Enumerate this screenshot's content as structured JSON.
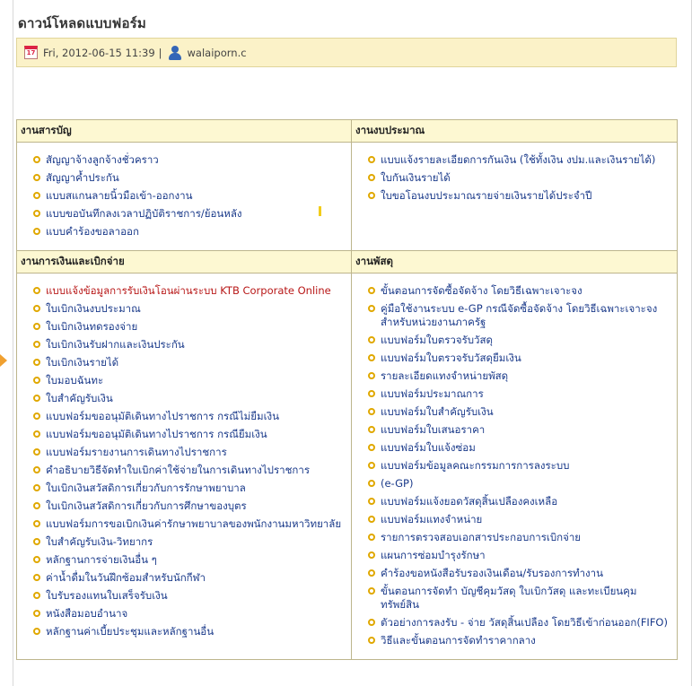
{
  "page": {
    "title": "ดาวน์โหลดแบบฟอร์ม",
    "date": "Fri, 2012-06-15 11:39",
    "separator": "|",
    "author": "walaiporn.c",
    "calendar_icon_text": "17"
  },
  "sections": {
    "general": {
      "title": "งานสารบัญ",
      "items": [
        "สัญญาจ้างลูกจ้างชั่วคราว",
        "สัญญาค้ำประกัน",
        "แบบสแกนลายนิ้วมือเข้า-ออกงาน",
        "แบบขอบันทึกลงเวลาปฏิบัติราชการ/ย้อนหลัง",
        "แบบคำร้องขอลาออก"
      ]
    },
    "budget": {
      "title": "งานงบประมาณ",
      "items": [
        "แบบแจ้งรายละเอียดการกันเงิน (ใช้ทั้งเงิน งปม.และเงินรายได้)",
        "ใบกันเงินรายได้",
        "ใบขอโอนงบประมาณรายจ่ายเงินรายได้ประจำปี"
      ]
    },
    "finance": {
      "title": "งานการเงินและเบิกจ่าย",
      "items": [
        "แบบแจ้งข้อมูลการรับเงินโอนผ่านระบบ KTB Corporate Online",
        "ใบเบิกเงินงบประมาณ",
        "ใบเบิกเงินทดรองจ่าย",
        "ใบเบิกเงินรับฝากและเงินประกัน",
        "ใบเบิกเงินรายได้",
        "ใบมอบฉันทะ",
        "ใบสำคัญรับเงิน",
        "แบบฟอร์มขออนุมัติเดินทางไปราชการ กรณีไม่ยืมเงิน",
        "แบบฟอร์มขออนุมัติเดินทางไปราชการ กรณียืมเงิน",
        "แบบฟอร์มรายงานการเดินทางไปราชการ",
        "คำอธิบายวิธีจัดทำใบเบิกค่าใช้จ่ายในการเดินทางไปราชการ",
        "ใบเบิกเงินสวัสดิการเกี่ยวกับการรักษาพยาบาล",
        "ใบเบิกเงินสวัสดิการเกี่ยวกับการศึกษาของบุตร",
        "แบบฟอร์มการขอเบิกเงินค่ารักษาพยาบาลของพนักงานมหาวิทยาลัย",
        "ใบสำคัญรับเงิน-วิทยากร",
        "หลักฐานการจ่ายเงินอื่น ๆ",
        "ค่าน้ำดื่มในวันฝึกซ้อมสำหรับนักกีฬา",
        "ใบรับรองแทนใบเสร็จรับเงิน",
        "หนังสือมอบอำนาจ",
        "หลักฐานค่าเบี้ยประชุมและหลักฐานอื่น"
      ]
    },
    "supplies": {
      "title": "งานพัสดุ",
      "items": [
        "ขั้นตอนการจัดซื้อจัดจ้าง โดยวิธีเฉพาะเจาะจง",
        "คู่มือใช้งานระบบ e-GP กรณีจัดซื้อจัดจ้าง โดยวิธีเฉพาะเจาะจง สำหรับหน่วยงานภาครัฐ",
        "แบบฟอร์มใบตรวจรับวัสดุ",
        "แบบฟอร์มใบตรวจรับวัสดุยืมเงิน",
        "รายละเอียดแทงจำหน่ายพัสดุ",
        "แบบฟอร์มประมาณการ",
        "แบบฟอร์มใบสำคัญรับเงิน",
        "แบบฟอร์มใบเสนอราคา",
        "แบบฟอร์มใบแจ้งซ่อม",
        "แบบฟอร์มข้อมูลคณะกรรมการการลงระบบ",
        "(e-GP)",
        "แบบฟอร์มแจ้งยอดวัสดุสิ้นเปลืองคงเหลือ",
        "แบบฟอร์มแทงจำหน่าย",
        "รายการตรวจสอบเอกสารประกอบการเบิกจ่าย",
        "แผนการซ่อมบำรุงรักษา",
        "คำร้องขอหนังสือรับรองเงินเดือน/รับรองการทำงาน",
        "ขั้นตอนการจัดทำ บัญชีคุมวัสดุ ใบเบิกวัสดุ และทะเบียนคุมทรัพย์สิน",
        "ตัวอย่างการลงรับ - จ่าย วัสดุสิ้นเปลือง โดยวิธีเข้าก่อนออก(FIFO)",
        "วิธีและขั้นตอนการจัดทำราคากลาง"
      ]
    }
  }
}
